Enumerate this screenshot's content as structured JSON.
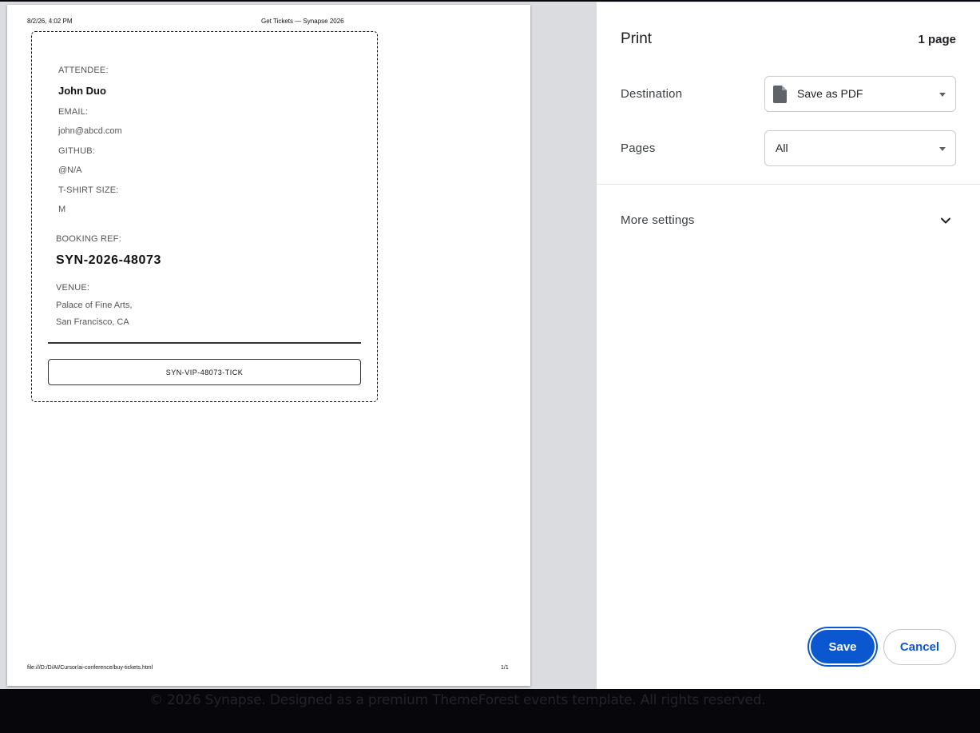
{
  "background_page": {
    "footer_text": "© 2026 Synapse. Designed as a premium ThemeForest events template. All rights reserved."
  },
  "preview": {
    "header_date": "8/2/26, 4:02 PM",
    "header_title": "Get Tickets — Synapse 2026",
    "footer_path": "file:///D:/D/AI/Cursor/ai-conference/buy-tickets.html",
    "footer_page": "1/1",
    "ticket": {
      "attendee_label": "ATTENDEE:",
      "attendee_name": "John Duo",
      "email_label": "EMAIL:",
      "email": "john@abcd.com",
      "github_label": "GITHUB:",
      "github": "@N/A",
      "tshirt_label": "T-SHIRT SIZE:",
      "tshirt": "M",
      "booking_label": "BOOKING REF:",
      "booking_ref": "SYN-2026-48073",
      "venue_label": "VENUE:",
      "venue_line1": "Palace of Fine Arts,",
      "venue_line2": "San Francisco, CA",
      "ticket_code": "SYN-VIP-48073-TICK"
    }
  },
  "print_dialog": {
    "title": "Print",
    "page_count": "1 page",
    "destination_label": "Destination",
    "destination_value": "Save as PDF",
    "pages_label": "Pages",
    "pages_value": "All",
    "more_settings_label": "More settings",
    "save_label": "Save",
    "cancel_label": "Cancel",
    "accent_color": "#0b57d0"
  }
}
